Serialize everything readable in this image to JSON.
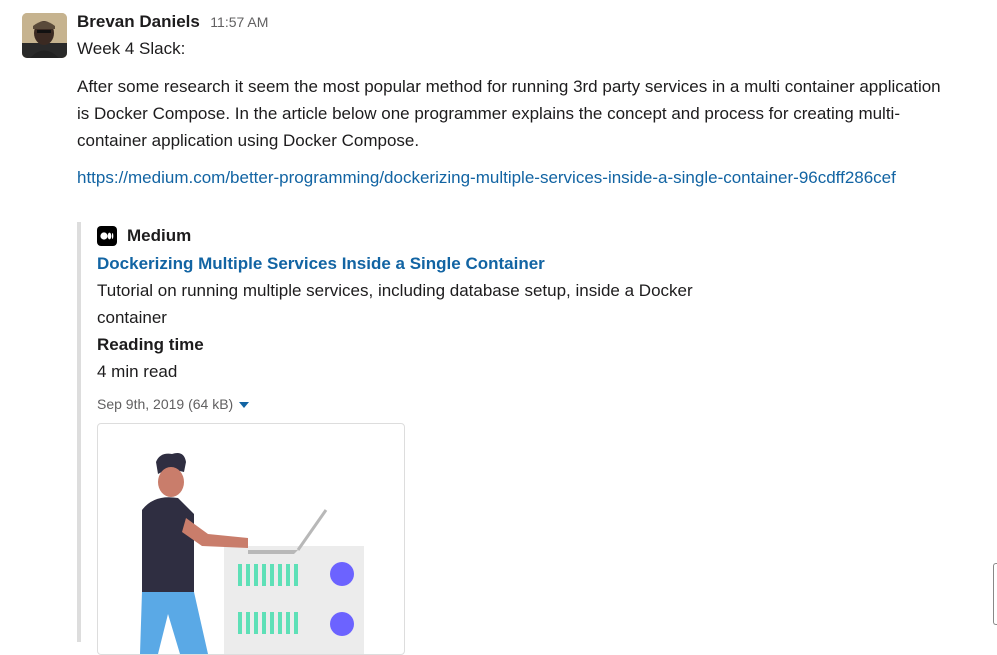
{
  "message": {
    "author": "Brevan Daniels",
    "time": "11:57 AM",
    "line1": "Week 4 Slack:",
    "paragraph": " After some research it seem the most popular method for running 3rd party services in a multi container application is Docker Compose. In the article below one programmer explains the concept and process for creating multi-container application using Docker Compose.",
    "link": "https://medium.com/better-programming/dockerizing-multiple-services-inside-a-single-container-96cdff286cef"
  },
  "unfurl": {
    "service": "Medium",
    "title": "Dockerizing Multiple Services Inside a Single Container",
    "description": "Tutorial on running multiple services, including database setup, inside a Docker container",
    "field_title": "Reading time",
    "field_value": "4 min read",
    "meta": "Sep 9th, 2019 (64 kB)"
  },
  "colors": {
    "link": "#1264a3",
    "unfurl_border": "#dddddd",
    "server_dot": "#6c63ff"
  },
  "icons": {
    "service_icon": "medium-icon",
    "caret": "caret-down-icon"
  }
}
